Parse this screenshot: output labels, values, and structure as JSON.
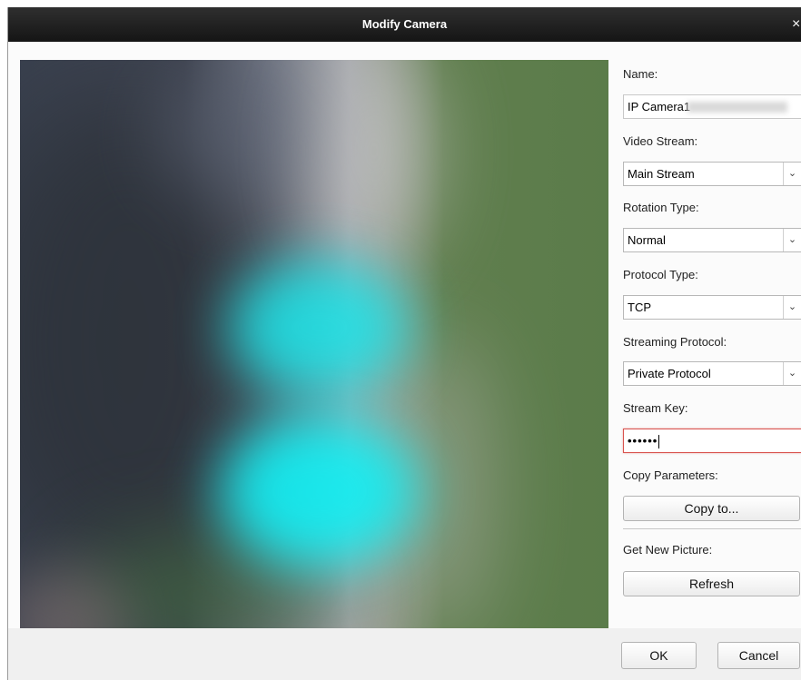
{
  "dialog": {
    "title": "Modify Camera",
    "close_glyph": "×"
  },
  "form": {
    "name": {
      "label": "Name:",
      "value": "IP Camera1"
    },
    "video_stream": {
      "label": "Video Stream:",
      "value": "Main Stream"
    },
    "rotation_type": {
      "label": "Rotation Type:",
      "value": "Normal"
    },
    "protocol_type": {
      "label": "Protocol Type:",
      "value": "TCP"
    },
    "streaming_protocol": {
      "label": "Streaming Protocol:",
      "value": "Private Protocol"
    },
    "stream_key": {
      "label": "Stream Key:",
      "value": "••••••"
    },
    "copy_parameters": {
      "label": "Copy Parameters:",
      "button": "Copy to..."
    },
    "get_new_picture": {
      "label": "Get New Picture:",
      "button": "Refresh"
    }
  },
  "footer": {
    "ok": "OK",
    "cancel": "Cancel"
  },
  "icons": {
    "dropdown": "chevron-down-icon",
    "close": "close-icon"
  },
  "colors": {
    "titlebar": "#1e1e1e",
    "focus_border": "#d9534f"
  }
}
